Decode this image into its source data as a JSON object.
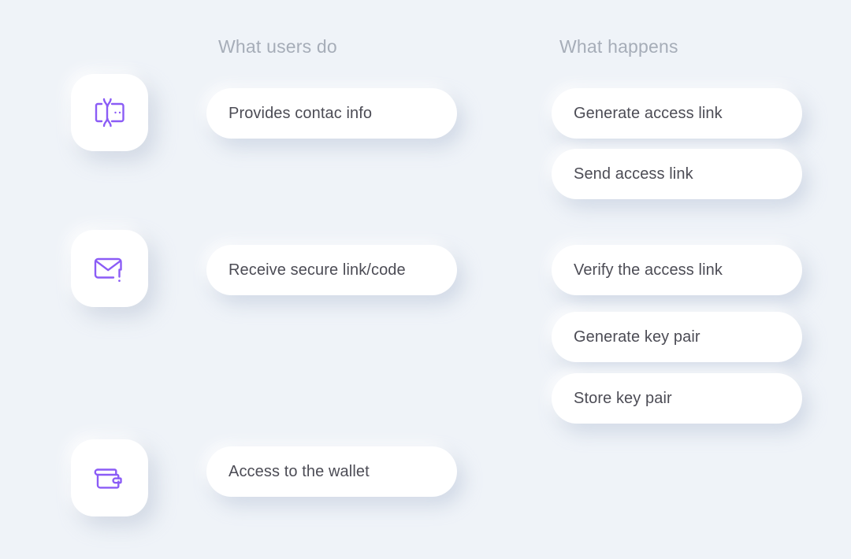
{
  "theme": {
    "background": "#eff3f8",
    "card_surface": "#ffffff",
    "accent_purple": "#8b5cf6",
    "header_text": "#a6adb8",
    "pill_text": "#4c4c55"
  },
  "columns": {
    "users": {
      "header": "What users do"
    },
    "happens": {
      "header": "What happens"
    }
  },
  "icons": [
    {
      "name": "contact-card-icon",
      "label": "contact card"
    },
    {
      "name": "envelope-alert-icon",
      "label": "envelope with alert"
    },
    {
      "name": "wallet-icon",
      "label": "wallet"
    }
  ],
  "user_steps": [
    {
      "label": "Provides contac info"
    },
    {
      "label": "Receive secure link/code"
    },
    {
      "label": "Access to the wallet"
    }
  ],
  "system_steps": [
    {
      "label": "Generate access link"
    },
    {
      "label": "Send access link"
    },
    {
      "label": "Verify the access link"
    },
    {
      "label": "Generate key pair"
    },
    {
      "label": "Store key pair"
    }
  ]
}
